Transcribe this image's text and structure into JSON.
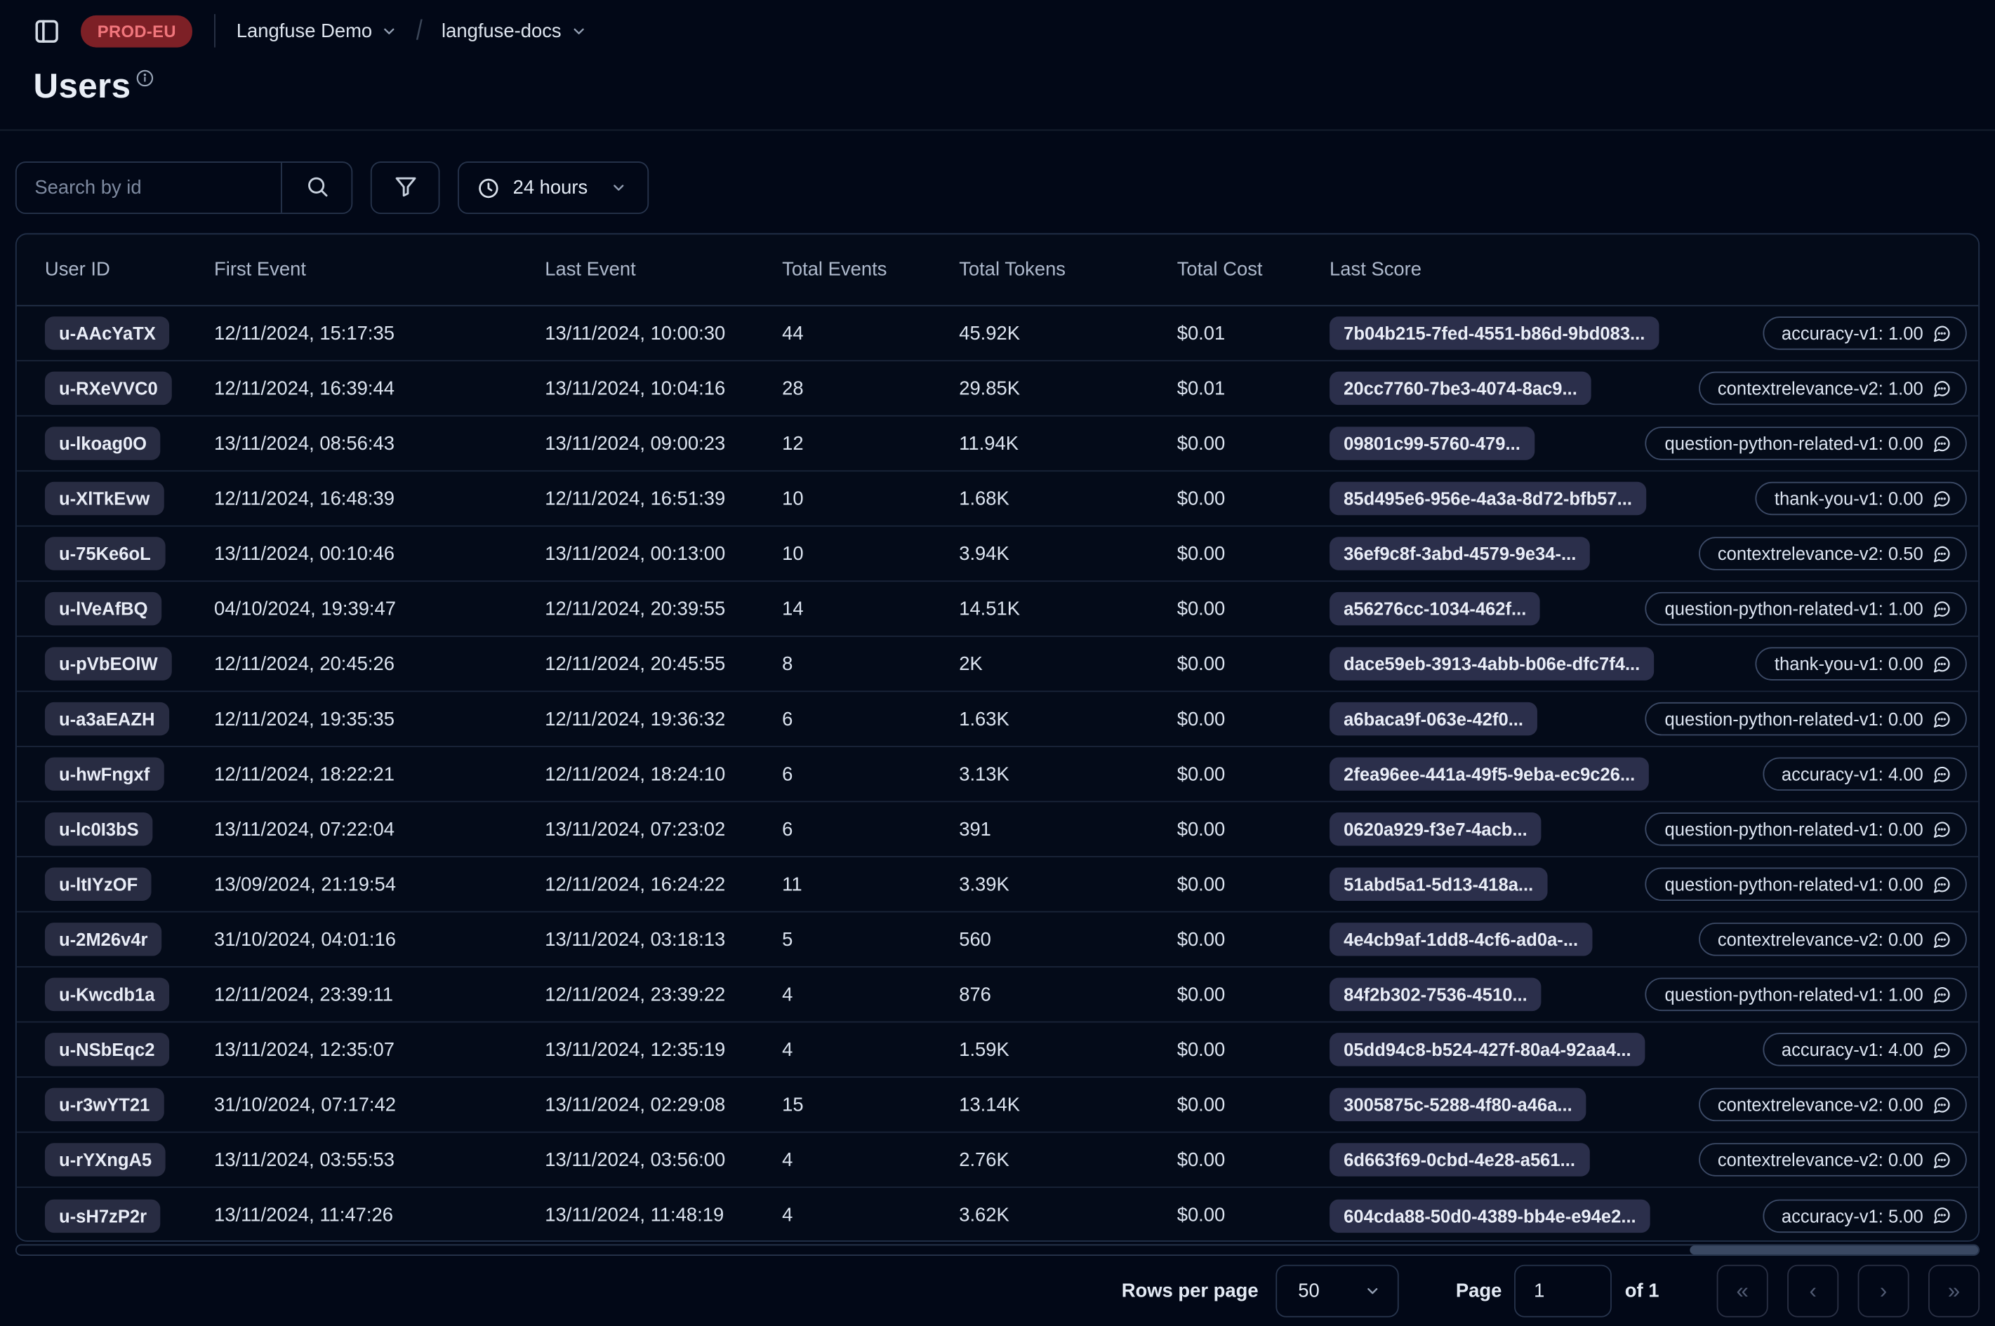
{
  "topbar": {
    "env_badge": "PROD-EU",
    "org_name": "Langfuse Demo",
    "project_name": "langfuse-docs",
    "breadcrumb_separator": "/"
  },
  "page": {
    "title": "Users"
  },
  "toolbar": {
    "search_placeholder": "Search by id",
    "time_range_value": "24 hours"
  },
  "table": {
    "columns": [
      "User ID",
      "First Event",
      "Last Event",
      "Total Events",
      "Total Tokens",
      "Total Cost",
      "Last Score"
    ],
    "rows": [
      {
        "user_id": "u-AAcYaTX",
        "first_event": "12/11/2024, 15:17:35",
        "last_event": "13/11/2024, 10:00:30",
        "total_events": "44",
        "total_tokens": "45.92K",
        "total_cost": "$0.01",
        "score_id": "7b04b215-7fed-4551-b86d-9bd083...",
        "score_label": "accuracy-v1: 1.00"
      },
      {
        "user_id": "u-RXeVVC0",
        "first_event": "12/11/2024, 16:39:44",
        "last_event": "13/11/2024, 10:04:16",
        "total_events": "28",
        "total_tokens": "29.85K",
        "total_cost": "$0.01",
        "score_id": "20cc7760-7be3-4074-8ac9...",
        "score_label": "contextrelevance-v2: 1.00"
      },
      {
        "user_id": "u-lkoag0O",
        "first_event": "13/11/2024, 08:56:43",
        "last_event": "13/11/2024, 09:00:23",
        "total_events": "12",
        "total_tokens": "11.94K",
        "total_cost": "$0.00",
        "score_id": "09801c99-5760-479...",
        "score_label": "question-python-related-v1: 0.00"
      },
      {
        "user_id": "u-XlTkEvw",
        "first_event": "12/11/2024, 16:48:39",
        "last_event": "12/11/2024, 16:51:39",
        "total_events": "10",
        "total_tokens": "1.68K",
        "total_cost": "$0.00",
        "score_id": "85d495e6-956e-4a3a-8d72-bfb57...",
        "score_label": "thank-you-v1: 0.00"
      },
      {
        "user_id": "u-75Ke6oL",
        "first_event": "13/11/2024, 00:10:46",
        "last_event": "13/11/2024, 00:13:00",
        "total_events": "10",
        "total_tokens": "3.94K",
        "total_cost": "$0.00",
        "score_id": "36ef9c8f-3abd-4579-9e34-...",
        "score_label": "contextrelevance-v2: 0.50"
      },
      {
        "user_id": "u-lVeAfBQ",
        "first_event": "04/10/2024, 19:39:47",
        "last_event": "12/11/2024, 20:39:55",
        "total_events": "14",
        "total_tokens": "14.51K",
        "total_cost": "$0.00",
        "score_id": "a56276cc-1034-462f...",
        "score_label": "question-python-related-v1: 1.00"
      },
      {
        "user_id": "u-pVbEOlW",
        "first_event": "12/11/2024, 20:45:26",
        "last_event": "12/11/2024, 20:45:55",
        "total_events": "8",
        "total_tokens": "2K",
        "total_cost": "$0.00",
        "score_id": "dace59eb-3913-4abb-b06e-dfc7f4...",
        "score_label": "thank-you-v1: 0.00"
      },
      {
        "user_id": "u-a3aEAZH",
        "first_event": "12/11/2024, 19:35:35",
        "last_event": "12/11/2024, 19:36:32",
        "total_events": "6",
        "total_tokens": "1.63K",
        "total_cost": "$0.00",
        "score_id": "a6baca9f-063e-42f0...",
        "score_label": "question-python-related-v1: 0.00"
      },
      {
        "user_id": "u-hwFngxf",
        "first_event": "12/11/2024, 18:22:21",
        "last_event": "12/11/2024, 18:24:10",
        "total_events": "6",
        "total_tokens": "3.13K",
        "total_cost": "$0.00",
        "score_id": "2fea96ee-441a-49f5-9eba-ec9c26...",
        "score_label": "accuracy-v1: 4.00"
      },
      {
        "user_id": "u-lc0I3bS",
        "first_event": "13/11/2024, 07:22:04",
        "last_event": "13/11/2024, 07:23:02",
        "total_events": "6",
        "total_tokens": "391",
        "total_cost": "$0.00",
        "score_id": "0620a929-f3e7-4acb...",
        "score_label": "question-python-related-v1: 0.00"
      },
      {
        "user_id": "u-ltIYzOF",
        "first_event": "13/09/2024, 21:19:54",
        "last_event": "12/11/2024, 16:24:22",
        "total_events": "11",
        "total_tokens": "3.39K",
        "total_cost": "$0.00",
        "score_id": "51abd5a1-5d13-418a...",
        "score_label": "question-python-related-v1: 0.00"
      },
      {
        "user_id": "u-2M26v4r",
        "first_event": "31/10/2024, 04:01:16",
        "last_event": "13/11/2024, 03:18:13",
        "total_events": "5",
        "total_tokens": "560",
        "total_cost": "$0.00",
        "score_id": "4e4cb9af-1dd8-4cf6-ad0a-...",
        "score_label": "contextrelevance-v2: 0.00"
      },
      {
        "user_id": "u-Kwcdb1a",
        "first_event": "12/11/2024, 23:39:11",
        "last_event": "12/11/2024, 23:39:22",
        "total_events": "4",
        "total_tokens": "876",
        "total_cost": "$0.00",
        "score_id": "84f2b302-7536-4510...",
        "score_label": "question-python-related-v1: 1.00"
      },
      {
        "user_id": "u-NSbEqc2",
        "first_event": "13/11/2024, 12:35:07",
        "last_event": "13/11/2024, 12:35:19",
        "total_events": "4",
        "total_tokens": "1.59K",
        "total_cost": "$0.00",
        "score_id": "05dd94c8-b524-427f-80a4-92aa4...",
        "score_label": "accuracy-v1: 4.00"
      },
      {
        "user_id": "u-r3wYT21",
        "first_event": "31/10/2024, 07:17:42",
        "last_event": "13/11/2024, 02:29:08",
        "total_events": "15",
        "total_tokens": "13.14K",
        "total_cost": "$0.00",
        "score_id": "3005875c-5288-4f80-a46a...",
        "score_label": "contextrelevance-v2: 0.00"
      },
      {
        "user_id": "u-rYXngA5",
        "first_event": "13/11/2024, 03:55:53",
        "last_event": "13/11/2024, 03:56:00",
        "total_events": "4",
        "total_tokens": "2.76K",
        "total_cost": "$0.00",
        "score_id": "6d663f69-0cbd-4e28-a561...",
        "score_label": "contextrelevance-v2: 0.00"
      },
      {
        "user_id": "u-sH7zP2r",
        "first_event": "13/11/2024, 11:47:26",
        "last_event": "13/11/2024, 11:48:19",
        "total_events": "4",
        "total_tokens": "3.62K",
        "total_cost": "$0.00",
        "score_id": "604cda88-50d0-4389-bb4e-e94e2...",
        "score_label": "accuracy-v1: 5.00"
      }
    ]
  },
  "footer": {
    "rows_per_page_label": "Rows per page",
    "rows_per_page_value": "50",
    "page_label": "Page",
    "page_value": "1",
    "page_total_label": "of 1",
    "pager": {
      "first": "«",
      "prev": "‹",
      "next": "›",
      "last": "»"
    }
  },
  "colors": {
    "background": "#020817",
    "env_badge_bg": "#7d2026",
    "env_badge_text": "#f1767c",
    "badge_bg": "#282c42",
    "pill_border": "#3c4a66",
    "row_border": "#1a2539",
    "card_border": "#223049"
  }
}
